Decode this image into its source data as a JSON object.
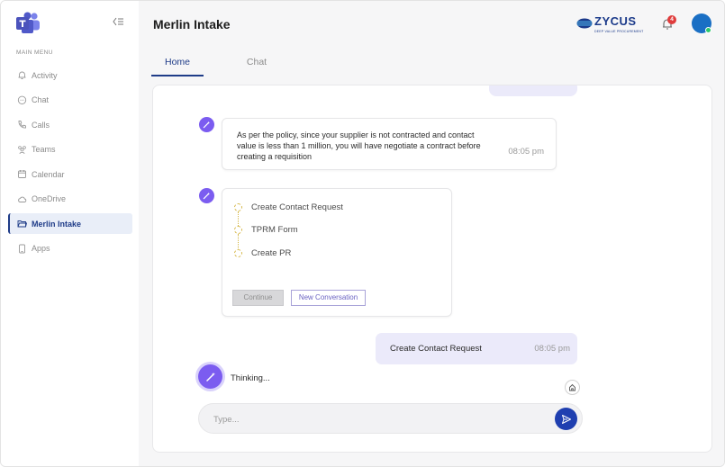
{
  "sidebar": {
    "menu_title": "MAIN MENU",
    "collapse_icon": "collapse-left-icon",
    "items": [
      {
        "label": "Activity",
        "icon": "bell-icon"
      },
      {
        "label": "Chat",
        "icon": "chat-icon"
      },
      {
        "label": "Calls",
        "icon": "phone-icon"
      },
      {
        "label": "Teams",
        "icon": "teams-icon"
      },
      {
        "label": "Calendar",
        "icon": "calendar-icon"
      },
      {
        "label": "OneDrive",
        "icon": "cloud-icon"
      },
      {
        "label": "Merlin Intake",
        "icon": "folder-icon",
        "active": true
      },
      {
        "label": "Apps",
        "icon": "apps-icon"
      }
    ]
  },
  "header": {
    "title": "Merlin Intake",
    "brand_name": "ZYCUS",
    "brand_tagline": "DEEP VALUE PROCUREMENT",
    "notification_count": "4"
  },
  "tabs": [
    {
      "label": "Home",
      "active": true
    },
    {
      "label": "Chat",
      "active": false
    }
  ],
  "chat": {
    "bot_message": {
      "text": "As per the policy, since your supplier is not contracted and contact value is less than 1 million, you will have negotiate a contract before creating a requisition",
      "time": "08:05 pm"
    },
    "steps": [
      "Create Contact Request",
      "TPRM Form",
      "Create PR"
    ],
    "continue_label": "Continue",
    "new_conversation_label": "New Conversation",
    "user_message": {
      "text": "Create Contact Request",
      "time": "08:05 pm"
    },
    "thinking_text": "Thinking...",
    "input_placeholder": "Type..."
  },
  "colors": {
    "accent": "#1f3c88",
    "bot_purple": "#7b5cf0",
    "user_bubble": "#ebeafa",
    "send_button": "#1f3fb0",
    "badge": "#e03c3c"
  }
}
